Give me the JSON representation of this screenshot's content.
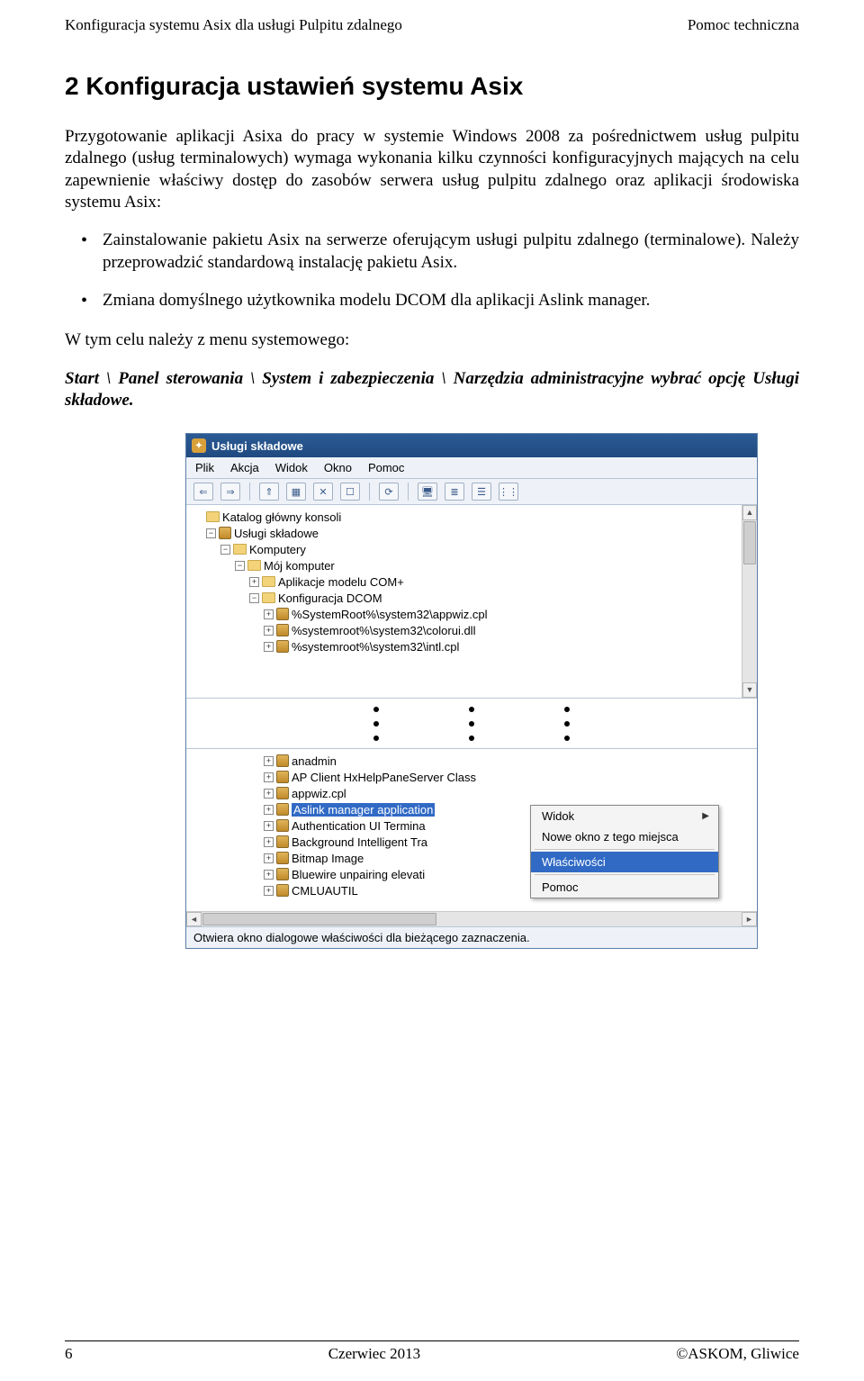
{
  "header": {
    "left": "Konfiguracja systemu Asix dla usługi Pulpitu zdalnego",
    "right": "Pomoc techniczna"
  },
  "section_title": "2  Konfiguracja ustawień systemu Asix",
  "para1": "Przygotowanie aplikacji Asixa do pracy w systemie Windows 2008 za pośrednictwem usług pulpitu zdalnego (usług terminalowych) wymaga wykonania kilku czynności konfiguracyjnych mających na celu zapewnienie właściwy dostęp do zasobów serwera usług pulpitu zdalnego oraz aplikacji środowiska systemu Asix:",
  "bullets": [
    "Zainstalowanie pakietu Asix na serwerze oferującym usługi pulpitu zdalnego (terminalowe). Należy  przeprowadzić standardową instalację pakietu Asix.",
    "Zmiana domyślnego użytkownika modelu DCOM dla aplikacji Aslink manager."
  ],
  "para2": "W tym celu należy z menu systemowego:",
  "para3_prefix": "Start \\ Panel sterowania \\ System i zabezpieczenia \\ Narzędzia administracyjne wybrać opcję Usługi składowe.",
  "win": {
    "title": "Usługi składowe",
    "menu": [
      "Plik",
      "Akcja",
      "Widok",
      "Okno",
      "Pomoc"
    ],
    "tree1": [
      {
        "ind": 0,
        "exp": "",
        "icon": "fld",
        "label": "Katalog główny konsoli"
      },
      {
        "ind": 1,
        "exp": "−",
        "icon": "box3d",
        "label": "Usługi składowe"
      },
      {
        "ind": 2,
        "exp": "−",
        "icon": "fld",
        "label": "Komputery"
      },
      {
        "ind": 3,
        "exp": "−",
        "icon": "fld",
        "label": "Mój komputer"
      },
      {
        "ind": 4,
        "exp": "+",
        "icon": "fld",
        "label": "Aplikacje modelu COM+"
      },
      {
        "ind": 4,
        "exp": "−",
        "icon": "fld",
        "label": "Konfiguracja DCOM"
      },
      {
        "ind": 5,
        "exp": "+",
        "icon": "box3d",
        "label": "%SystemRoot%\\system32\\appwiz.cpl"
      },
      {
        "ind": 5,
        "exp": "+",
        "icon": "box3d",
        "label": "%systemroot%\\system32\\colorui.dll"
      },
      {
        "ind": 5,
        "exp": "+",
        "icon": "box3d",
        "label": "%systemroot%\\system32\\intl.cpl"
      }
    ],
    "tree2": [
      {
        "ind": 5,
        "exp": "+",
        "icon": "box3d",
        "label": "anadmin"
      },
      {
        "ind": 5,
        "exp": "+",
        "icon": "box3d",
        "label": "AP Client HxHelpPaneServer Class"
      },
      {
        "ind": 5,
        "exp": "+",
        "icon": "box3d",
        "label": "appwiz.cpl"
      },
      {
        "ind": 5,
        "exp": "+",
        "icon": "box3d",
        "label": "Aslink manager application",
        "sel": true
      },
      {
        "ind": 5,
        "exp": "+",
        "icon": "box3d",
        "label": "Authentication UI Termina"
      },
      {
        "ind": 5,
        "exp": "+",
        "icon": "box3d",
        "label": "Background Intelligent Tra"
      },
      {
        "ind": 5,
        "exp": "+",
        "icon": "box3d",
        "label": "Bitmap Image"
      },
      {
        "ind": 5,
        "exp": "+",
        "icon": "box3d",
        "label": "Bluewire unpairing elevati"
      },
      {
        "ind": 5,
        "exp": "+",
        "icon": "box3d",
        "label": "CMLUAUTIL"
      }
    ],
    "ctx": [
      {
        "label": "Widok",
        "sub": true
      },
      {
        "label": "Nowe okno z tego miejsca"
      },
      {
        "sep": true
      },
      {
        "label": "Właściwości",
        "hl": true
      },
      {
        "sep": true
      },
      {
        "label": "Pomoc"
      }
    ],
    "status": "Otwiera okno dialogowe właściwości dla bieżącego zaznaczenia."
  },
  "footer": {
    "left": "6",
    "center": "Czerwiec 2013",
    "right": "©ASKOM, Gliwice"
  }
}
